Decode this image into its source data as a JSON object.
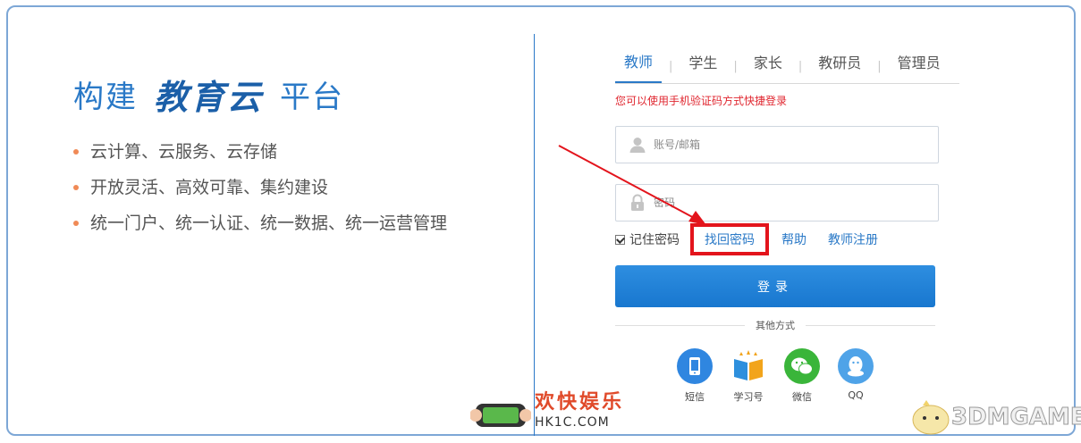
{
  "hero": {
    "title_prefix": "构建",
    "title_brand": "教育云",
    "title_suffix": "平台",
    "features": [
      "云计算、云服务、云存储",
      "开放灵活、高效可靠、集约建设",
      "统一门户、统一认证、统一数据、统一运营管理"
    ]
  },
  "tabs": [
    "教师",
    "学生",
    "家长",
    "教研员",
    "管理员"
  ],
  "active_tab": "教师",
  "login": {
    "hint": "您可以使用手机验证码方式快捷登录",
    "account_placeholder": "账号/邮箱",
    "password_placeholder": "密码",
    "remember_label": "记住密码",
    "remember_checked": true,
    "forgot_label": "找回密码",
    "help_label": "帮助",
    "register_label": "教师注册",
    "submit_label": "登录"
  },
  "other": {
    "label": "其他方式",
    "methods": [
      {
        "label": "短信",
        "icon": "phone-icon",
        "color": "#2f86e0"
      },
      {
        "label": "学习号",
        "icon": "book-icon",
        "color": "#f2a41b"
      },
      {
        "label": "微信",
        "icon": "wechat-icon",
        "color": "#3ab53a"
      },
      {
        "label": "QQ",
        "icon": "qq-icon",
        "color": "#4fa3e8"
      }
    ]
  },
  "watermarks": {
    "hk_cn": "欢快娱乐",
    "hk_en": "HK1C.COM",
    "game": "3DMGAME"
  },
  "colors": {
    "accent": "#2a79c7",
    "highlight": "#e3141c",
    "hint": "#e0262f"
  }
}
